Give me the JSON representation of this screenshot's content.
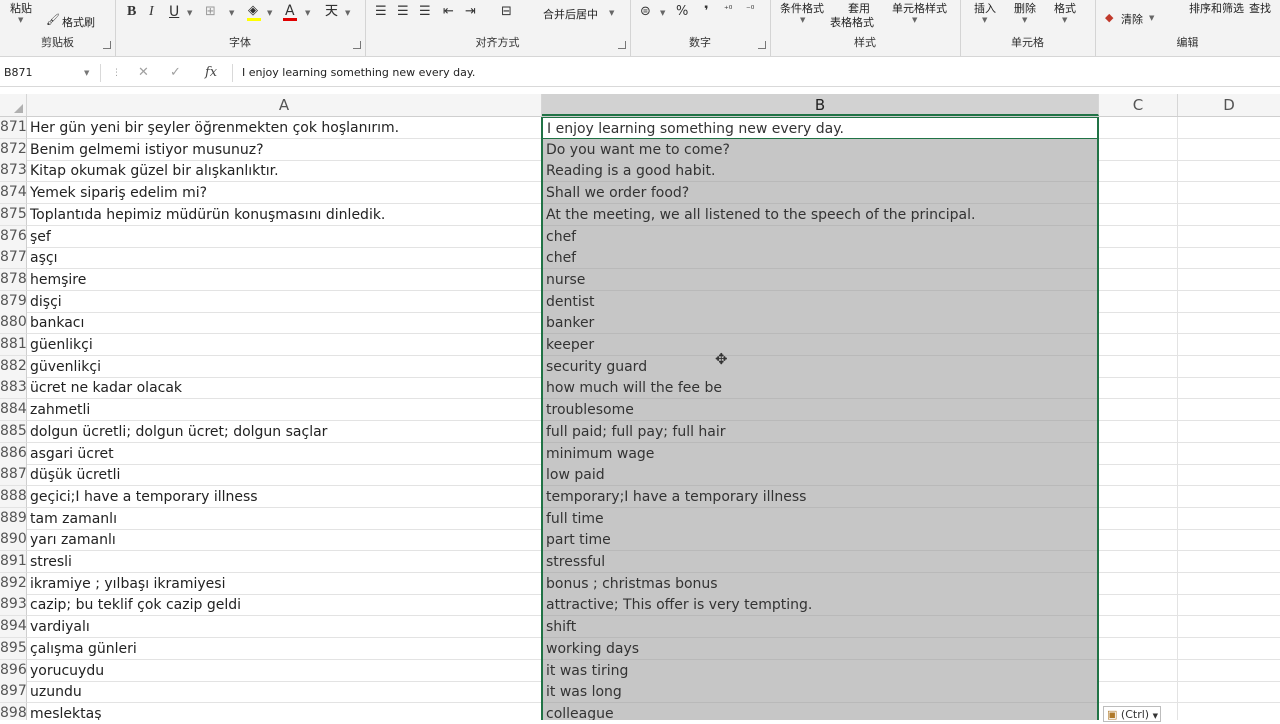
{
  "ribbon": {
    "clipboard": {
      "label": "剪贴板",
      "paste": "粘贴",
      "format_painter": "格式刷"
    },
    "font": {
      "label": "字体",
      "bold": "B",
      "italic": "I",
      "underline": "U",
      "font_color_letter": "A"
    },
    "alignment": {
      "label": "对齐方式",
      "merge_center": "合并后居中"
    },
    "number": {
      "label": "数字",
      "percent": "%",
      "comma": "❜"
    },
    "styles": {
      "label": "样式",
      "conditional_format": "条件格式",
      "table_format_1": "套用",
      "table_format_2": "表格格式",
      "cell_styles": "单元格样式"
    },
    "cells": {
      "label": "单元格",
      "insert": "插入",
      "delete": "删除",
      "format": "格式"
    },
    "editing": {
      "label": "编辑",
      "clear": "清除",
      "sort_filter": "排序和筛选",
      "find_select": "查找"
    }
  },
  "formula_bar": {
    "name_box": "B871",
    "cancel": "✕",
    "enter": "✓",
    "fx": "fx",
    "content": "I enjoy learning something new every day."
  },
  "columns": [
    "A",
    "B",
    "C",
    "D"
  ],
  "rows": [
    {
      "num": "871",
      "a": "Her gün yeni bir şeyler öğrenmekten çok hoşlanırım.",
      "b": "I enjoy learning something new every day."
    },
    {
      "num": "872",
      "a": "Benim gelmemi istiyor musunuz?",
      "b": "Do you want me to come?"
    },
    {
      "num": "873",
      "a": "Kitap okumak güzel bir alışkanlıktır.",
      "b": "Reading is a good habit."
    },
    {
      "num": "874",
      "a": "Yemek sipariş edelim mi?",
      "b": "Shall we order food?"
    },
    {
      "num": "875",
      "a": "Toplantıda hepimiz müdürün konuşmasını dinledik.",
      "b": "At the meeting, we all listened to the speech of the principal."
    },
    {
      "num": "876",
      "a": "şef",
      "b": "chef"
    },
    {
      "num": "877",
      "a": "aşçı",
      "b": "chef"
    },
    {
      "num": "878",
      "a": "hemşire",
      "b": "nurse"
    },
    {
      "num": "879",
      "a": "dişçi",
      "b": "dentist"
    },
    {
      "num": "880",
      "a": "bankacı",
      "b": "banker"
    },
    {
      "num": "881",
      "a": "güenlikçi",
      "b": "keeper"
    },
    {
      "num": "882",
      "a": "güvenlikçi",
      "b": "security guard"
    },
    {
      "num": "883",
      "a": "ücret ne kadar olacak",
      "b": "how much will the fee be"
    },
    {
      "num": "884",
      "a": "zahmetli",
      "b": "troublesome"
    },
    {
      "num": "885",
      "a": "dolgun ücretli; dolgun ücret; dolgun saçlar",
      "b": "full paid; full pay; full hair"
    },
    {
      "num": "886",
      "a": "asgari ücret",
      "b": "minimum wage"
    },
    {
      "num": "887",
      "a": "düşük ücretli",
      "b": "low paid"
    },
    {
      "num": "888",
      "a": "geçici;I have a temporary illness",
      "b": "temporary;I have a temporary illness"
    },
    {
      "num": "889",
      "a": "tam zamanlı",
      "b": "full time"
    },
    {
      "num": "890",
      "a": "yarı zamanlı",
      "b": "part time"
    },
    {
      "num": "891",
      "a": "stresli",
      "b": "stressful"
    },
    {
      "num": "892",
      "a": "ikramiye ; yılbaşı ikramiyesi",
      "b": "bonus ; christmas bonus"
    },
    {
      "num": "893",
      "a": "cazip; bu teklif çok cazip geldi",
      "b": "attractive; This offer is very tempting."
    },
    {
      "num": "894",
      "a": "vardiyalı",
      "b": "shift"
    },
    {
      "num": "895",
      "a": "çalışma günleri",
      "b": "working days"
    },
    {
      "num": "896",
      "a": "yorucuydu",
      "b": "it was tiring"
    },
    {
      "num": "897",
      "a": "uzundu",
      "b": "it was long"
    },
    {
      "num": "898",
      "a": "meslektaş",
      "b": "colleague"
    }
  ],
  "paste_options": {
    "label": "(Ctrl)"
  }
}
